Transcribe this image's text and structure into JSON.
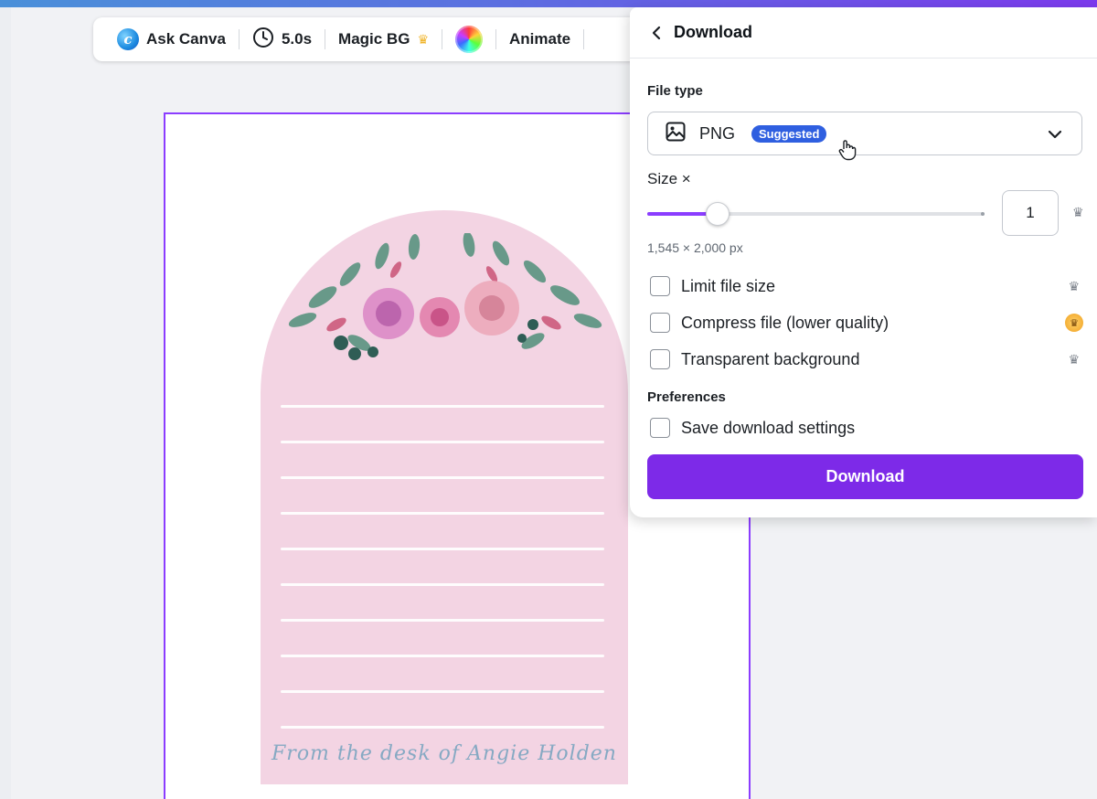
{
  "toolbar": {
    "ask_canva": "Ask Canva",
    "duration": "5.0s",
    "magic_bg": "Magic BG",
    "animate": "Animate"
  },
  "design": {
    "signature": "From the desk of Angie Holden"
  },
  "download_panel": {
    "title": "Download",
    "file_type_label": "File type",
    "file_type": "PNG",
    "suggested_badge": "Suggested",
    "size_label": "Size ×",
    "size_value": "1",
    "size_slider_fraction": 0.21,
    "dimensions": "1,545 × 2,000 px",
    "options": [
      {
        "label": "Limit file size",
        "checked": false,
        "premium": "crown"
      },
      {
        "label": "Compress file (lower quality)",
        "checked": false,
        "premium": "crown-gold"
      },
      {
        "label": "Transparent background",
        "checked": false,
        "premium": "crown"
      }
    ],
    "preferences_label": "Preferences",
    "save_settings": "Save download settings",
    "download_button": "Download"
  },
  "colors": {
    "accent": "#7d2ae8",
    "selection_border": "#8b3dff",
    "badge": "#2f5fe0",
    "arch_pink": "#f3d4e3"
  }
}
